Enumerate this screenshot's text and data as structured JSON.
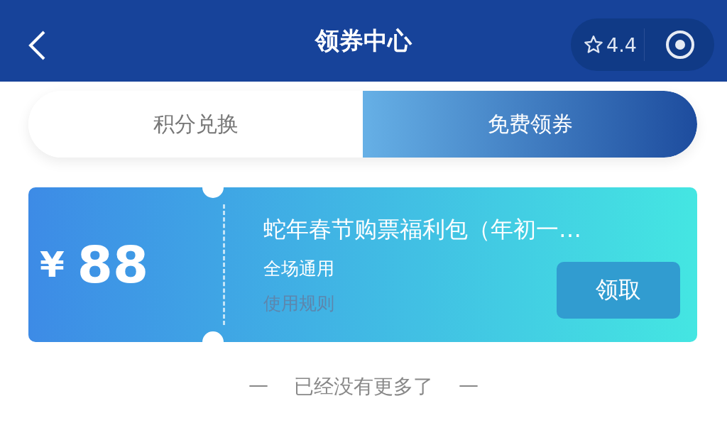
{
  "header": {
    "title": "领券中心",
    "rating": "4.4"
  },
  "tabs": [
    {
      "label": "积分兑换",
      "selected": false
    },
    {
      "label": "免费领券",
      "selected": true
    }
  ],
  "coupons": [
    {
      "currency": "¥",
      "amount": "88",
      "title": "蛇年春节购票福利包（年初一…",
      "scope": "全场通用",
      "rules": "使用规则",
      "action": "领取"
    }
  ],
  "footer": {
    "dash_left": "—",
    "text": "已经没有更多了",
    "dash_right": "—"
  }
}
